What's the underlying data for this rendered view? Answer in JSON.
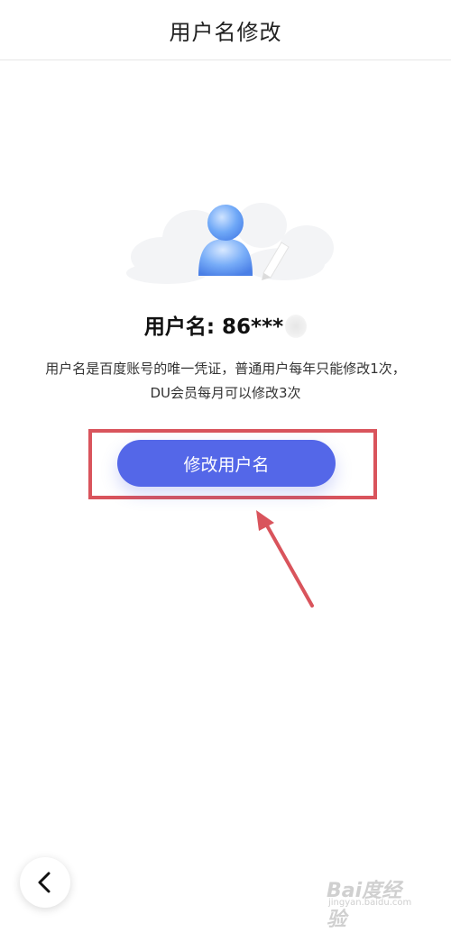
{
  "header": {
    "title": "用户名修改"
  },
  "illustration": {
    "icon": "user-avatar-edit-illustration",
    "accent": "#5aa0f5"
  },
  "profile": {
    "username_label": "用户名: 86***",
    "description": "用户名是百度账号的唯一凭证，普通用户每年只能修改1次，DU会员每月可以修改3次"
  },
  "actions": {
    "modify_button_label": "修改用户名"
  },
  "annotation": {
    "color": "#d9545c"
  },
  "nav": {
    "back_icon": "chevron-left-icon"
  },
  "watermark": {
    "text": "Bai度经验",
    "sub": "jingyan.baidu.com"
  },
  "colors": {
    "primary": "#5467e8",
    "title": "#222222"
  }
}
